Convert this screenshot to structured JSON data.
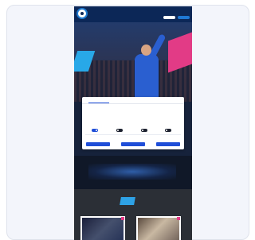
{
  "header": {
    "nav": [
      "",
      "",
      "",
      "",
      ""
    ],
    "lang": "",
    "login_label": "",
    "shop_label": ""
  },
  "hero": {
    "title": "",
    "subtitle": ""
  },
  "consent": {
    "tabs": [
      "",
      "",
      ""
    ],
    "title": "",
    "body": "",
    "toggles": [
      {
        "label": "",
        "on": true
      },
      {
        "label": "",
        "on": false
      },
      {
        "label": "",
        "on": false
      },
      {
        "label": "",
        "on": false
      }
    ],
    "buttons": [
      "",
      "",
      ""
    ]
  },
  "banner": {
    "text": "",
    "tag": ""
  },
  "news": {
    "tag": ""
  },
  "colors": {
    "header_bg": "#0c2757",
    "accent_blue": "#1f4ed8",
    "accent_pink": "#e23b86",
    "accent_cyan": "#2ea2e6"
  }
}
